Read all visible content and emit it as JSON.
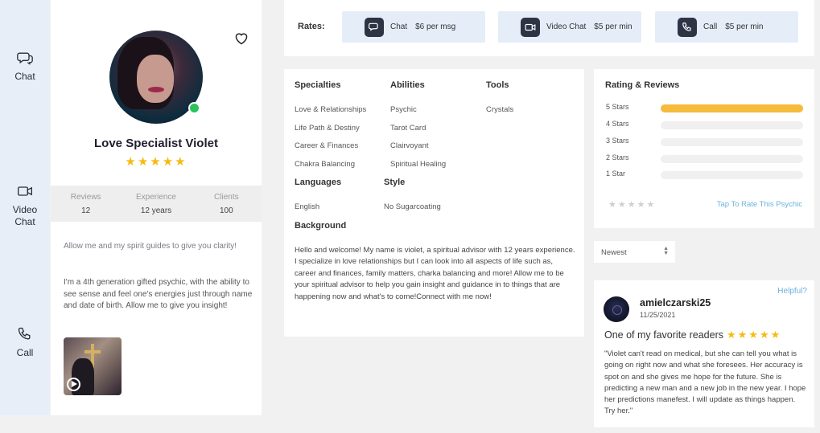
{
  "rail": {
    "chat": "Chat",
    "video_chat": [
      "Video",
      "Chat"
    ],
    "call": "Call"
  },
  "profile": {
    "name": "Love Specialist Violet",
    "rating_stars": "★★★★★",
    "status": "online",
    "stats": [
      {
        "label": "Reviews",
        "value": "12"
      },
      {
        "label": "Experience",
        "value": "12 years"
      },
      {
        "label": "Clients",
        "value": "100"
      }
    ],
    "bio_intro": "Allow me and my spirit guides to give you clarity!",
    "bio_detail": "I'm a 4th generation gifted psychic, with the ability to see sense and feel one's energies just through name and date of birth. Allow me to give you insight!",
    "video_icon": "play-icon"
  },
  "rates": {
    "title": "Rates:",
    "items": [
      {
        "type": "Chat",
        "price": "$6 per msg",
        "icon": "chat-icon"
      },
      {
        "type": "Video Chat",
        "price": "$5 per min",
        "icon": "video-icon"
      },
      {
        "type": "Call",
        "price": "$5 per min",
        "icon": "phone-icon"
      }
    ]
  },
  "details": {
    "specialties": {
      "title": "Specialties",
      "items": [
        "Love & Relationships",
        "Life Path & Destiny",
        "Career & Finances",
        "Chakra Balancing"
      ]
    },
    "abilities": {
      "title": "Abilities",
      "items": [
        "Psychic",
        "Tarot Card",
        "Clairvoyant",
        "Spiritual Healing"
      ]
    },
    "tools": {
      "title": "Tools",
      "items": [
        "Crystals"
      ]
    },
    "languages": {
      "title": "Languages",
      "items": [
        "English"
      ]
    },
    "style": {
      "title": "Style",
      "items": [
        "No Sugarcoating"
      ]
    },
    "background": {
      "title": "Background",
      "text": "Hello and welcome! My name is violet, a spiritual advisor with 12 years experience. I specialize in love relationships but I can look into all aspects of life such as, career and finances, family matters, charka balancing and more! Allow me to be your spiritual advisor to help you gain insight and guidance in to things that are happening now and what's to come!Connect with me now!"
    }
  },
  "ratings": {
    "title": "Rating & Reviews",
    "rows": [
      {
        "label": "5 Stars",
        "fraction": 1.0
      },
      {
        "label": "4 Stars",
        "fraction": 0
      },
      {
        "label": "3 Stars",
        "fraction": 0
      },
      {
        "label": "2 Stars",
        "fraction": 0
      },
      {
        "label": "1 Star",
        "fraction": 0
      }
    ],
    "user_stars": "★★★★★",
    "tap_to_rate": "Tap To Rate This Psychic",
    "bar_color": "#f5bb3c"
  },
  "sort": {
    "value": "Newest"
  },
  "review": {
    "helpful": "Helpful?",
    "user": "amielczarski25",
    "date": "11/25/2021",
    "title": "One of my favorite readers",
    "stars": "★★★★★",
    "body": "\"Violet can't read on medical, but she can tell you what is going on right now and what she foresees. Her accuracy is spot on and she gives me hope for the future. She is predicting a new man and a new job in the new year. I hope her predictions manefest. I will update as things happen. Try her.\""
  },
  "colors": {
    "accent_star": "#f5bb10",
    "link": "#6bb3de",
    "online": "#2ac35b",
    "rail_bg": "#e7eef8"
  }
}
